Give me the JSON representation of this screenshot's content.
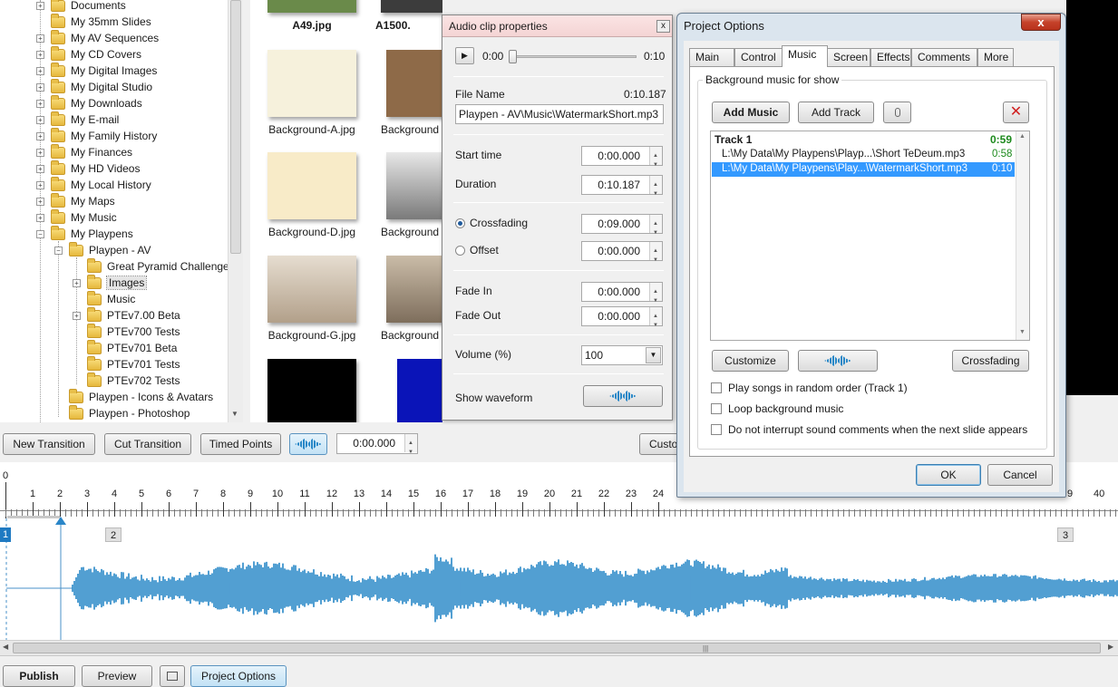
{
  "tree": {
    "items": [
      {
        "label": "Documents",
        "level": 0,
        "exp": true
      },
      {
        "label": "My 35mm Slides",
        "level": 0,
        "exp": false
      },
      {
        "label": "My AV Sequences",
        "level": 0,
        "exp": true
      },
      {
        "label": "My CD Covers",
        "level": 0,
        "exp": true
      },
      {
        "label": "My Digital Images",
        "level": 0,
        "exp": true
      },
      {
        "label": "My Digital Studio",
        "level": 0,
        "exp": true
      },
      {
        "label": "My Downloads",
        "level": 0,
        "exp": true
      },
      {
        "label": "My E-mail",
        "level": 0,
        "exp": true
      },
      {
        "label": "My Family History",
        "level": 0,
        "exp": true
      },
      {
        "label": "My Finances",
        "level": 0,
        "exp": true
      },
      {
        "label": "My HD Videos",
        "level": 0,
        "exp": true
      },
      {
        "label": "My Local History",
        "level": 0,
        "exp": true
      },
      {
        "label": "My Maps",
        "level": 0,
        "exp": true
      },
      {
        "label": "My Music",
        "level": 0,
        "exp": true
      },
      {
        "label": "My Playpens",
        "level": 0,
        "exp": true,
        "open": true
      },
      {
        "label": "Playpen - AV",
        "level": 1,
        "exp": true,
        "open": true
      },
      {
        "label": "Great Pyramid Challenge",
        "level": 2,
        "exp": false
      },
      {
        "label": "Images",
        "level": 2,
        "exp": true,
        "selected": true
      },
      {
        "label": "Music",
        "level": 2,
        "exp": false
      },
      {
        "label": "PTEv7.00 Beta",
        "level": 2,
        "exp": true
      },
      {
        "label": "PTEv700 Tests",
        "level": 2,
        "exp": false
      },
      {
        "label": "PTEv701 Beta",
        "level": 2,
        "exp": false
      },
      {
        "label": "PTEv701 Tests",
        "level": 2,
        "exp": false
      },
      {
        "label": "PTEv702 Tests",
        "level": 2,
        "exp": false
      },
      {
        "label": "Playpen - Icons & Avatars",
        "level": 1,
        "exp": false
      },
      {
        "label": "Playpen - Photoshop",
        "level": 1,
        "exp": false
      }
    ]
  },
  "thumbs": [
    {
      "caption": "A49.jpg",
      "color": "#6a8a4a",
      "bold": true
    },
    {
      "caption": "A1500.",
      "color": "#3c3c3c",
      "bold": true
    },
    {
      "caption": "Background-A.jpg",
      "color": "#f6f1dc"
    },
    {
      "caption": "Background",
      "color": "#8e6a48"
    },
    {
      "caption": "Background-D.jpg",
      "color": "#f8ebc8"
    },
    {
      "caption": "Background",
      "color": "#8c8c8c"
    },
    {
      "caption": "Background-G.jpg",
      "color": "#c9b9a4"
    },
    {
      "caption": "Background",
      "color": "#9a8a78"
    },
    {
      "caption": "",
      "color": "#000000"
    },
    {
      "caption": "",
      "color": "#0a14b8"
    }
  ],
  "audio": {
    "title": "Audio clip properties",
    "close": "x",
    "play_pos": "0:00",
    "play_end": "0:10",
    "file_name_label": "File Name",
    "file_duration": "0:10.187",
    "file_name": "Playpen - AV\\Music\\WatermarkShort.mp3",
    "start_label": "Start time",
    "start": "0:00.000",
    "duration_label": "Duration",
    "duration": "0:10.187",
    "crossfading_label": "Crossfading",
    "crossfading": "0:09.000",
    "offset_label": "Offset",
    "offset": "0:00.000",
    "fadein_label": "Fade In",
    "fadein": "0:00.000",
    "fadeout_label": "Fade Out",
    "fadeout": "0:00.000",
    "volume_label": "Volume (%)",
    "volume": "100",
    "waveform_label": "Show waveform"
  },
  "proj": {
    "title": "Project Options",
    "close": "x",
    "tabs": [
      "Main",
      "Control",
      "Music",
      "Screen",
      "Effects",
      "Comments",
      "More"
    ],
    "active_tab": "Music",
    "group_label": "Background music for show",
    "add_music": "Add Music",
    "add_track": "Add Track",
    "track_header": "Track 1",
    "track_total": "0:59",
    "tracks": [
      {
        "path": "L:\\My Data\\My Playpens\\Playp...\\Short TeDeum.mp3",
        "time": "0:58"
      },
      {
        "path": "L:\\My Data\\My Playpens\\Play...\\WatermarkShort.mp3",
        "time": "0:10",
        "selected": true
      }
    ],
    "customize": "Customize",
    "crossfading": "Crossfading",
    "checks": [
      "Play songs in random order (Track 1)",
      "Loop background music",
      "Do not interrupt sound comments when the next slide appears"
    ],
    "ok": "OK",
    "cancel": "Cancel"
  },
  "toolbar": {
    "new_transition": "New Transition",
    "cut_transition": "Cut Transition",
    "timed_points": "Timed Points",
    "time": "0:00.000",
    "custom": "Custo"
  },
  "ruler": {
    "zero": "0",
    "numbers": [
      "1",
      "2",
      "3",
      "4",
      "5",
      "6",
      "7",
      "8",
      "9",
      "10",
      "11",
      "12",
      "13",
      "14",
      "15",
      "16",
      "17",
      "18",
      "19",
      "20",
      "21",
      "22",
      "23",
      "24"
    ],
    "right_numbers": [
      "9",
      "40"
    ]
  },
  "markers": [
    "1",
    "2",
    "3"
  ],
  "bottom": {
    "publish": "Publish",
    "preview": "Preview",
    "project_options": "Project Options"
  }
}
